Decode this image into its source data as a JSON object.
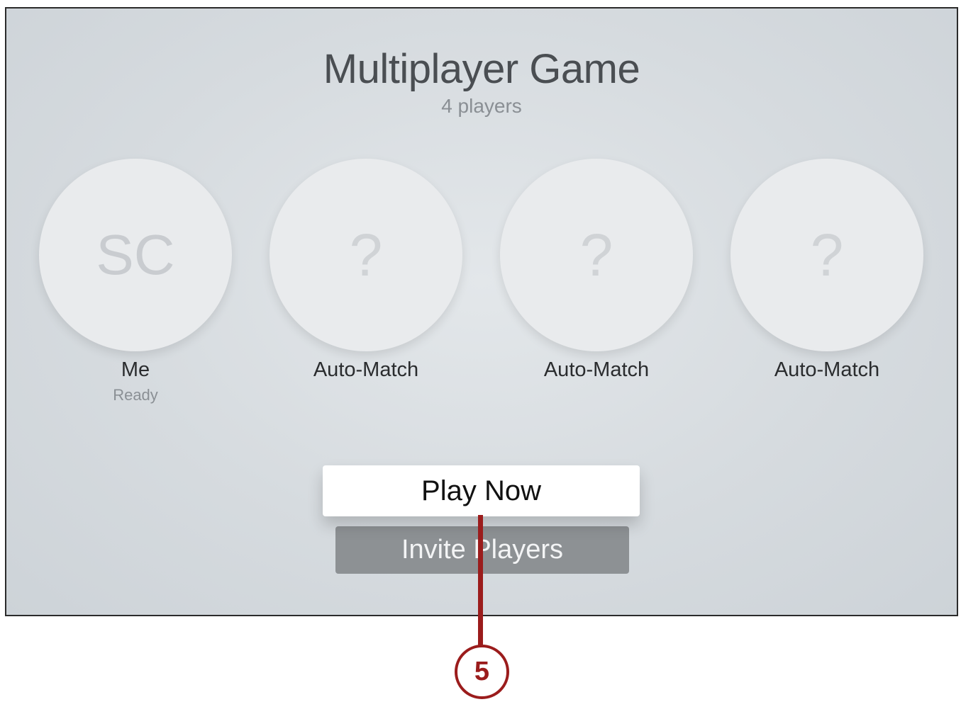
{
  "screen": {
    "title": "Multiplayer Game",
    "subtitle": "4 players"
  },
  "players": [
    {
      "avatar": "SC",
      "name": "Me",
      "status": "Ready"
    },
    {
      "avatar": "?",
      "name": "Auto-Match"
    },
    {
      "avatar": "?",
      "name": "Auto-Match"
    },
    {
      "avatar": "?",
      "name": "Auto-Match"
    }
  ],
  "buttons": {
    "play_now": "Play Now",
    "invite_players": "Invite Players"
  },
  "callout": {
    "number": "5",
    "color": "#9b1c1c"
  }
}
